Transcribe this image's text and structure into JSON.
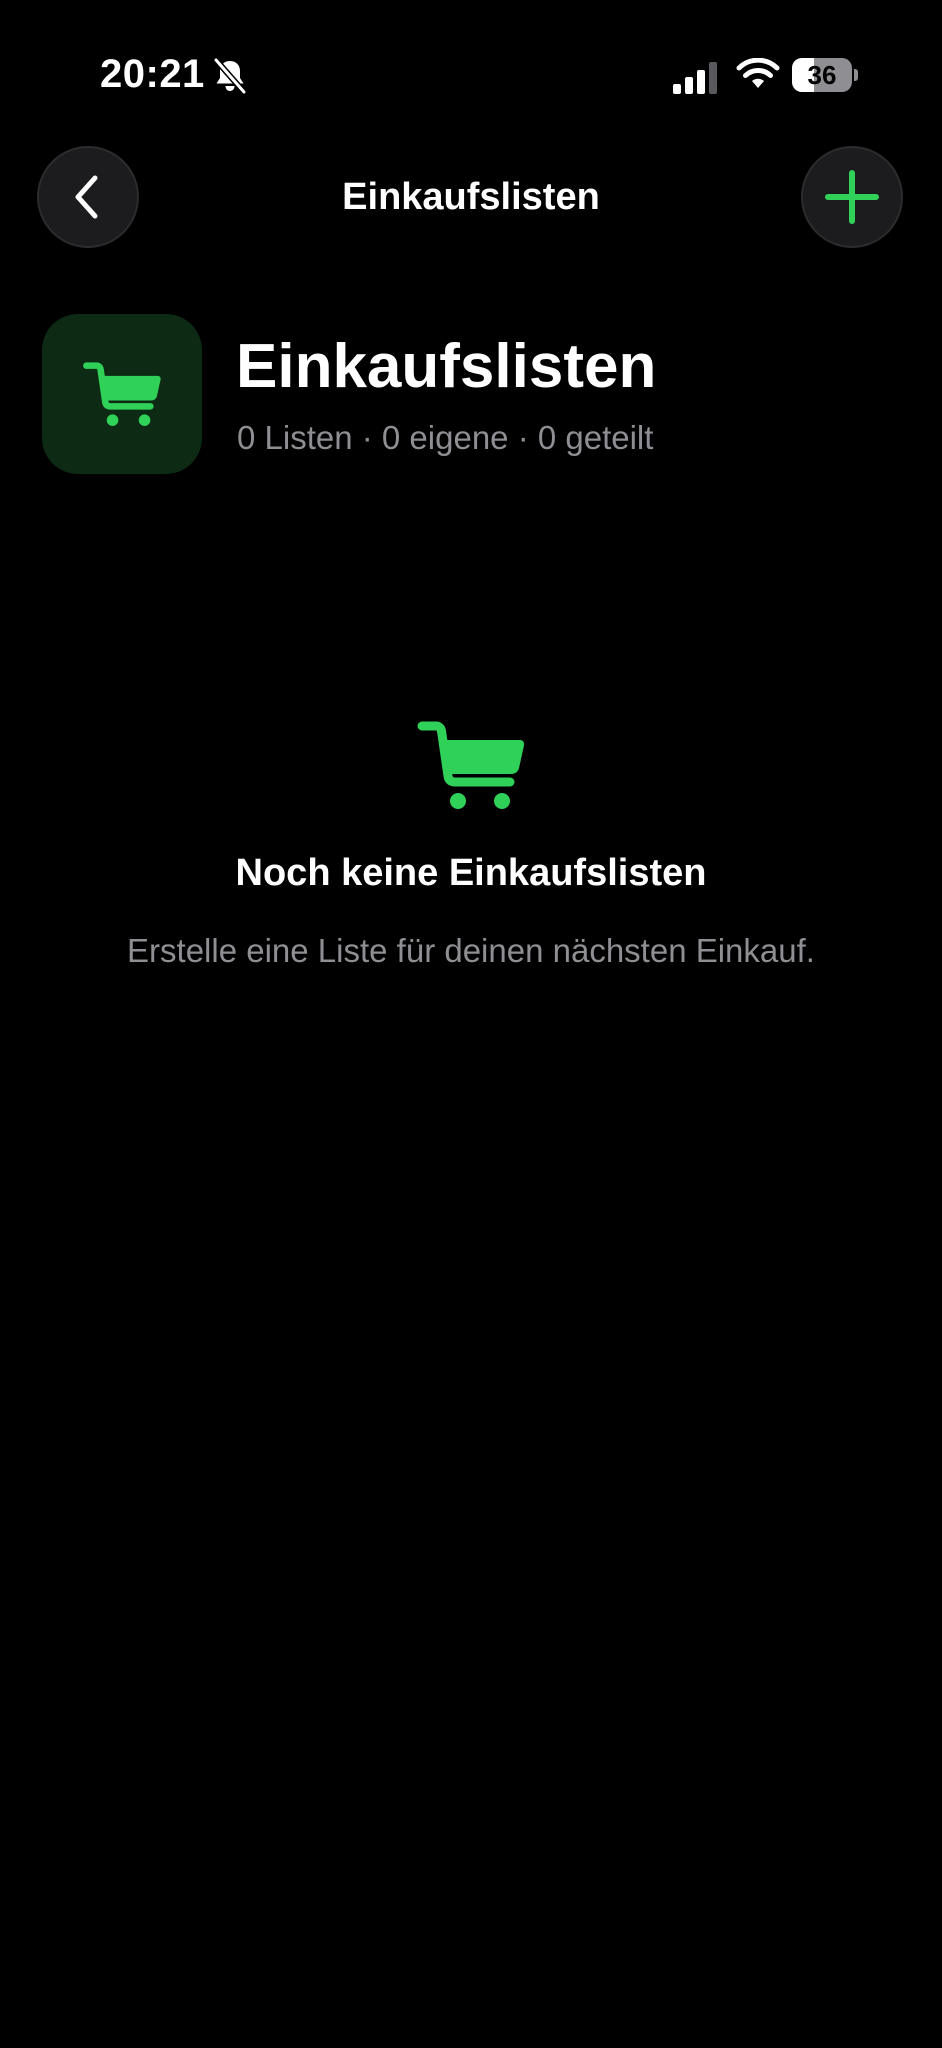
{
  "status_bar": {
    "time": "20:21",
    "battery_level": "36",
    "battery_fraction": 0.36,
    "icons": [
      "bell-slash-icon",
      "signal-icon",
      "wifi-icon",
      "battery-icon"
    ]
  },
  "nav": {
    "title": "Einkaufslisten",
    "back_icon": "chevron-left-icon",
    "add_icon": "plus-icon"
  },
  "header": {
    "title": "Einkaufslisten",
    "subtitle": "0 Listen · 0 eigene · 0 geteilt",
    "icon": "cart-icon"
  },
  "empty_state": {
    "icon": "cart-icon",
    "title": "Noch keine Einkaufslisten",
    "description": "Erstelle eine Liste für deinen nächsten Einkauf."
  },
  "colors": {
    "background": "#000000",
    "accent": "#30d158",
    "secondary_text": "#8e8e93",
    "button_background": "#1c1c1e",
    "icon_tile_background": "#0d2a14"
  }
}
